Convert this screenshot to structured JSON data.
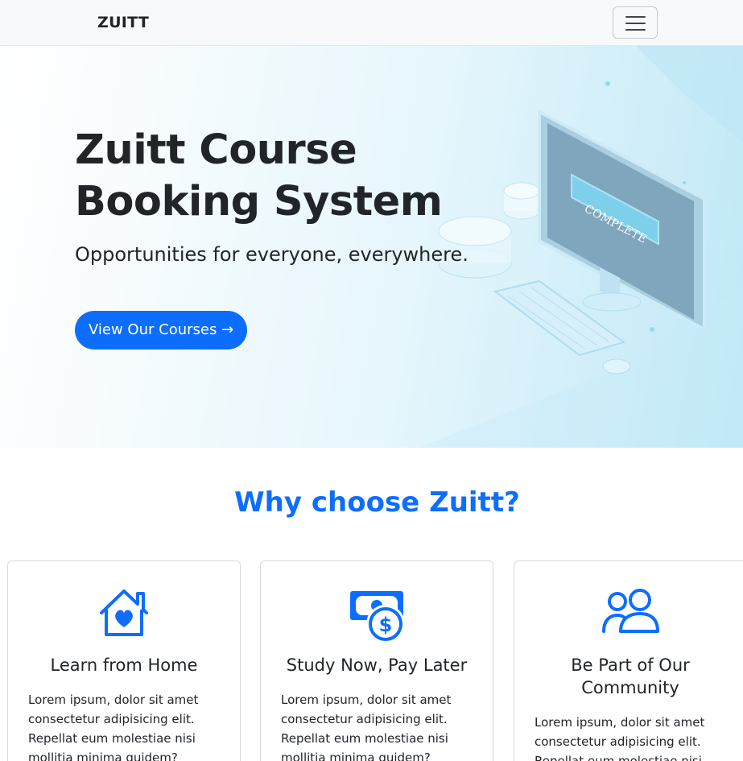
{
  "navbar": {
    "brand": "ZUITT",
    "toggler_icon": "hamburger-menu-icon"
  },
  "hero": {
    "title": "Zuitt Course Booking System",
    "subtitle": "Opportunities for everyone, everywhere.",
    "cta_label": "View Our Courses →",
    "illustration_text": "COMPLETE"
  },
  "features": {
    "heading": "Why choose Zuitt?",
    "cards": [
      {
        "icon": "house-heart-icon",
        "title": "Learn from Home",
        "text": "Lorem ipsum, dolor sit amet consectetur adipisicing elit. Repellat eum molestiae nisi mollitia minima quidem? Veniam"
      },
      {
        "icon": "cash-coin-icon",
        "title": "Study Now, Pay Later",
        "text": "Lorem ipsum, dolor sit amet consectetur adipisicing elit. Repellat eum molestiae nisi mollitia minima quidem? Veniam"
      },
      {
        "icon": "people-icon",
        "title": "Be Part of Our Community",
        "text": "Lorem ipsum, dolor sit amet consectetur adipisicing elit. Repellat eum molestiae nisi"
      }
    ]
  },
  "colors": {
    "primary": "#0d6efd",
    "navbar_bg": "#f8f9fa",
    "text": "#212529"
  }
}
